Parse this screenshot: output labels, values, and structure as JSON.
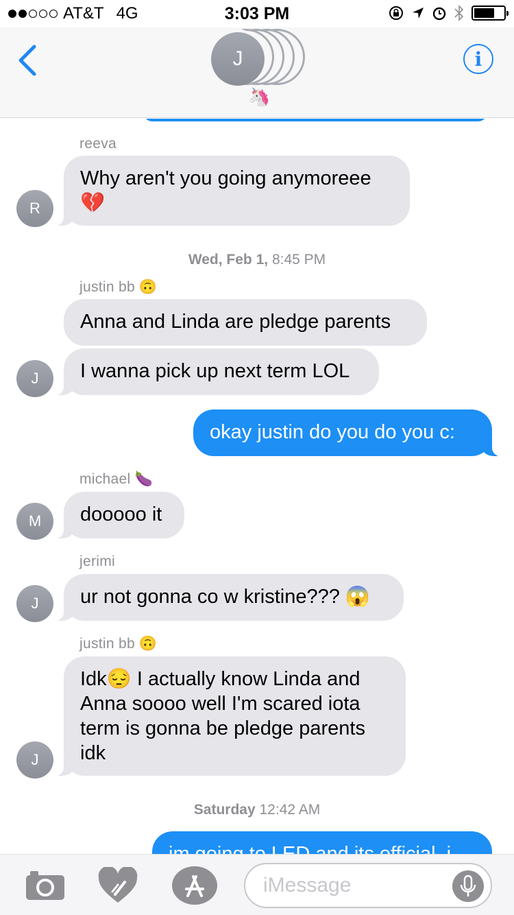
{
  "status_bar": {
    "carrier": "AT&T",
    "network": "4G",
    "time": "3:03 PM",
    "signal_bars_filled": 2,
    "signal_bars_total": 5,
    "battery_level": 0.7
  },
  "nav": {
    "group_initial": "J",
    "group_emoji": "🦄",
    "info_label": "i"
  },
  "messages": [
    {
      "sender": "reeva",
      "text": "Why aren't you going anymoreee",
      "text2": "💔",
      "avatar": "R"
    },
    {
      "timestamp_day": "Wed, Feb 1,",
      "timestamp_time": "8:45 PM"
    },
    {
      "sender": "justin bb",
      "sender_emoji": "🙃",
      "text": "Anna and Linda are pledge parents"
    },
    {
      "text": "I wanna pick up next term LOL",
      "avatar": "J"
    },
    {
      "text": "okay justin do you do you c:",
      "outgoing": true
    },
    {
      "sender": "michael",
      "sender_emoji": "🍆",
      "text": "dooooo it",
      "avatar": "M"
    },
    {
      "sender": "jerimi",
      "text": "ur not gonna co w kristine???",
      "text_emoji": "😱",
      "avatar": "J"
    },
    {
      "sender": "justin bb",
      "sender_emoji": "🙃",
      "lines": [
        "Idk😔 I actually know Linda and",
        "Anna soooo well I'm scared iota",
        "term is gonna be pledge parents",
        "idk"
      ],
      "avatar": "J"
    },
    {
      "timestamp_day": "Saturday",
      "timestamp_time": "12:42 AM"
    },
    {
      "text": "im going to LED and its official. i",
      "outgoing": true
    }
  ],
  "input": {
    "placeholder": "iMessage"
  },
  "icons": [
    "signal-dots-icon",
    "lock-rotation-icon",
    "location-arrow-icon",
    "alarm-icon",
    "bluetooth-icon",
    "battery-icon",
    "back-chevron-icon",
    "info-icon",
    "camera-icon",
    "digital-touch-heart-icon",
    "app-store-icon",
    "microphone-icon"
  ],
  "colors": {
    "accent": "#1f87f5",
    "outgoing_bubble": "#1d8ff5",
    "incoming_bubble": "#e5e5ea",
    "meta_text": "#8e8e93"
  }
}
